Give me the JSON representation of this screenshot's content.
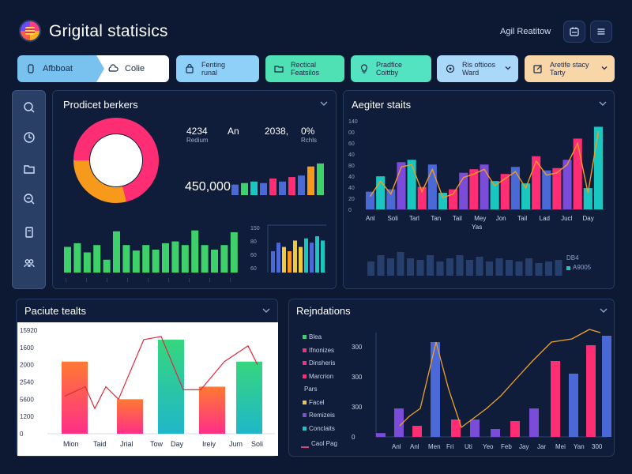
{
  "app": {
    "title": "Grigital statisics",
    "user": "Agil Reatitow"
  },
  "header": {
    "icons": [
      "calendar-icon",
      "menu-icon"
    ]
  },
  "pills": [
    {
      "label": "Afbboat",
      "icon": "file-icon"
    },
    {
      "label": "Colie",
      "icon": "cloud-icon"
    },
    {
      "label": "Fenting\nrunal",
      "icon": "bag-icon"
    },
    {
      "label": "Rectical\nFeatsilos",
      "icon": "folder-icon"
    },
    {
      "label": "Pradfice\nCoittby",
      "icon": "bulb-icon"
    },
    {
      "label": "Ris oftioos\nWard",
      "icon": "target-icon"
    },
    {
      "label": "Aretife stacy\nTarty",
      "icon": "edit-icon"
    }
  ],
  "sidebar": {
    "items": [
      "search-icon",
      "clock-icon",
      "folder-icon",
      "zoom-icon",
      "document-icon",
      "team-icon"
    ]
  },
  "panels": {
    "product": {
      "title": "Prodicet berkers",
      "donut_label": "71%",
      "stat1_value": "4234",
      "stat1_label": "Redium",
      "stat2_value": "An",
      "stat3_value": "2038,",
      "stat4_value": "0%",
      "stat4_label": "Rchls",
      "big_value": "450,000",
      "mini_axis": [
        "150",
        "80",
        "60",
        "60"
      ]
    },
    "register": {
      "title": "Aegiter staits",
      "legend1": "DB4",
      "legend2": "A9005"
    },
    "picture": {
      "title": "Paciute tealts"
    },
    "rejections": {
      "title": "Rejndations",
      "legend": [
        "Blea",
        "Ifnonizes",
        "Dinsheris",
        "Marcrion",
        "Pars",
        "Facel",
        "Remizeis",
        "Conclaits"
      ],
      "line_legend": "Caol Pag"
    }
  },
  "colors": {
    "green": "#3ed16a",
    "teal": "#19c7c0",
    "pink": "#ff2e74",
    "purple": "#7a4cd9",
    "blue": "#4a68d6",
    "orange": "#f79a1c",
    "yellow": "#f0c93a",
    "navy": "#2b4577"
  },
  "chart_data": [
    {
      "type": "pie",
      "values": [
        71,
        29
      ],
      "categories": [
        "pink",
        "orange"
      ]
    },
    {
      "type": "bar",
      "values": [
        14,
        16,
        18,
        16,
        22,
        18,
        24,
        26,
        38,
        42
      ]
    },
    {
      "type": "bar",
      "values": [
        28,
        32,
        22,
        30,
        14,
        45,
        30,
        24,
        30,
        25,
        32,
        34,
        30,
        46,
        30,
        25,
        30,
        44
      ]
    },
    {
      "type": "bar",
      "values": [
        10,
        14,
        12,
        10,
        15,
        12,
        16,
        14,
        17,
        15
      ],
      "ylim": [
        0,
        20
      ],
      "yticks": [
        "150",
        "80",
        "60",
        "60"
      ]
    },
    {
      "type": "bar",
      "title": "Aegiter staits",
      "categories": [
        "Anl",
        "Soli",
        "Tarl",
        "Tan",
        "Tail",
        "Mey",
        "Jon",
        "Tail",
        "Lad",
        "Jucl",
        "Day"
      ],
      "yticks": [
        "140",
        "00",
        "60",
        "40",
        "80",
        "40",
        "40",
        "20",
        "0"
      ],
      "xlabel": "Yas",
      "series": [
        {
          "values": [
            15,
            28,
            17,
            40,
            42,
            19,
            38,
            14,
            17,
            31,
            34,
            38,
            24,
            30,
            36,
            22,
            45,
            33,
            35,
            42,
            60,
            18,
            70
          ]
        }
      ]
    },
    {
      "type": "bar",
      "values": [
        18,
        26,
        22,
        30,
        22,
        20,
        26,
        18,
        22,
        26,
        20,
        24,
        18,
        22,
        20,
        18,
        22,
        16,
        18,
        20
      ]
    },
    {
      "type": "bar",
      "title": "Paciute tealts",
      "categories": [
        "Mion",
        "Taid",
        "Jrial",
        "Tow",
        "Day",
        "Ireiy",
        "Jum",
        "Soli"
      ],
      "yticks": [
        "15920",
        "1600",
        "2000",
        "2540",
        "5600",
        "1200",
        "0"
      ],
      "series": [
        {
          "values": [
            2300,
            1100,
            3000,
            1500,
            2300
          ]
        }
      ],
      "line": [
        1200,
        1500,
        800,
        1500,
        1100,
        3000,
        3100,
        1400,
        1400,
        2300,
        2800,
        2200
      ]
    },
    {
      "type": "bar",
      "title": "Rejndations",
      "categories": [
        "Anl",
        "Anl",
        "Men",
        "Fri",
        "Uti",
        "Yeo",
        "Feb",
        "Jay",
        "Jar",
        "Mei",
        "Yan",
        "300"
      ],
      "yticks": [
        "300",
        "300",
        "300",
        "0"
      ],
      "series": [
        {
          "values": [
            12,
            90,
            35,
            300,
            55,
            55,
            25,
            50,
            90,
            240,
            200,
            290,
            320
          ]
        }
      ],
      "line": [
        35,
        65,
        90,
        300,
        150,
        30,
        60,
        90,
        130,
        180,
        240,
        300,
        310,
        340,
        330
      ]
    }
  ]
}
